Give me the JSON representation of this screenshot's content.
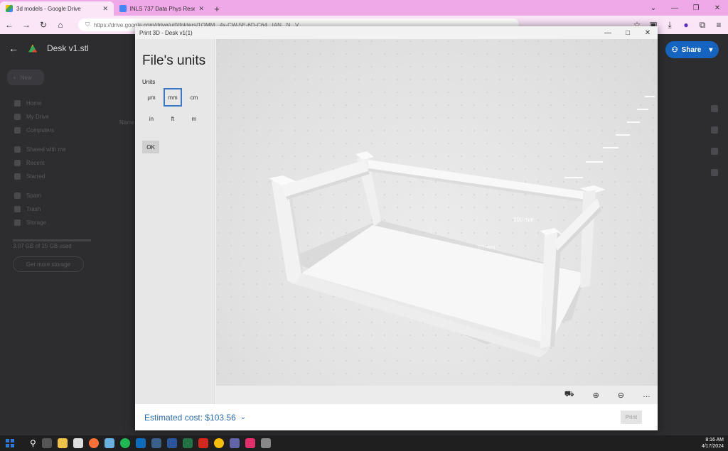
{
  "browser": {
    "tabs": [
      {
        "label": "3d models - Google Drive",
        "active": true
      },
      {
        "label": "INLS 737 Data Phys Research Gr",
        "active": false
      }
    ],
    "url": "https://drive.google.com/drive/u/0/folders/1OMM...4x-CW-5E-6D-C64...IAN...N...V"
  },
  "drive": {
    "file_title": "Desk v1.stl",
    "new_label": "New",
    "nav_items": [
      "Home",
      "My Drive",
      "Computers",
      "Shared with me",
      "Recent",
      "Starred",
      "Spam",
      "Trash",
      "Storage"
    ],
    "storage_text": "3.07 GB of 15 GB used",
    "storage_button": "Get more storage",
    "share_label": "Share",
    "name_header": "Name"
  },
  "print3d": {
    "window_title": "Print 3D - Desk v1(1)",
    "heading": "File's units",
    "units_label": "Units",
    "units": [
      "μm",
      "mm",
      "cm",
      "in",
      "ft",
      "m"
    ],
    "selected_unit": "mm",
    "ok_label": "OK",
    "ruler_labels": [
      "100 mm",
      "50 mm"
    ],
    "estimated_cost": "Estimated cost: $103.56",
    "print_label": "Print"
  },
  "taskbar": {
    "time": "8:16 AM",
    "date": "4/17/2024"
  },
  "colors": {
    "tabbar": "#f0a9e8",
    "accent": "#2a6cb3",
    "share": "#1565c0"
  }
}
